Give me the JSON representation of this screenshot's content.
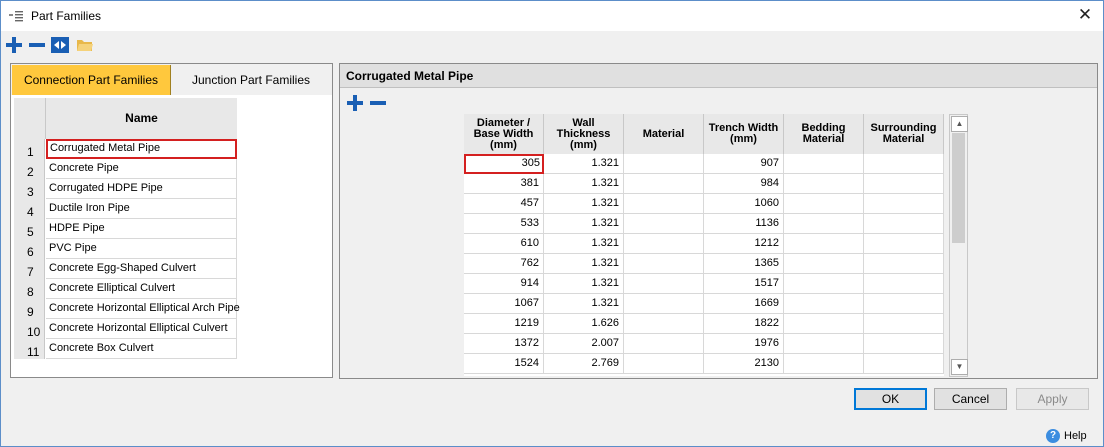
{
  "window": {
    "title": "Part Families",
    "close_glyph": "✕"
  },
  "toolbar": {
    "icons": [
      "add-icon",
      "remove-icon",
      "merge-icon",
      "open-folder-icon"
    ]
  },
  "tabs": [
    {
      "label": "Connection Part Families"
    },
    {
      "label": "Junction Part Families"
    }
  ],
  "families": {
    "header": "Name",
    "items": [
      {
        "num": "1",
        "name": "Corrugated Metal Pipe"
      },
      {
        "num": "2",
        "name": "Concrete Pipe"
      },
      {
        "num": "3",
        "name": "Corrugated HDPE Pipe"
      },
      {
        "num": "4",
        "name": "Ductile Iron Pipe"
      },
      {
        "num": "5",
        "name": "HDPE Pipe"
      },
      {
        "num": "6",
        "name": "PVC Pipe"
      },
      {
        "num": "7",
        "name": "Concrete Egg-Shaped Culvert"
      },
      {
        "num": "8",
        "name": "Concrete Elliptical Culvert"
      },
      {
        "num": "9",
        "name": "Concrete Horizontal Elliptical Arch Pipe"
      },
      {
        "num": "10",
        "name": "Concrete Horizontal Elliptical Culvert"
      },
      {
        "num": "11",
        "name": "Concrete Box Culvert"
      }
    ]
  },
  "detail": {
    "title": "Corrugated Metal Pipe",
    "columns": [
      "Diameter / Base Width (mm)",
      "Wall Thickness (mm)",
      "Material",
      "Trench Width (mm)",
      "Bedding Material",
      "Surrounding Material"
    ],
    "rows": [
      [
        "305",
        "1.321",
        "",
        "907",
        "",
        ""
      ],
      [
        "381",
        "1.321",
        "",
        "984",
        "",
        ""
      ],
      [
        "457",
        "1.321",
        "",
        "1060",
        "",
        ""
      ],
      [
        "533",
        "1.321",
        "",
        "1136",
        "",
        ""
      ],
      [
        "610",
        "1.321",
        "",
        "1212",
        "",
        ""
      ],
      [
        "762",
        "1.321",
        "",
        "1365",
        "",
        ""
      ],
      [
        "914",
        "1.321",
        "",
        "1517",
        "",
        ""
      ],
      [
        "1067",
        "1.321",
        "",
        "1669",
        "",
        ""
      ],
      [
        "1219",
        "1.626",
        "",
        "1822",
        "",
        ""
      ],
      [
        "1372",
        "2.007",
        "",
        "1976",
        "",
        ""
      ],
      [
        "1524",
        "2.769",
        "",
        "2130",
        "",
        ""
      ]
    ]
  },
  "buttons": {
    "ok": "OK",
    "cancel": "Cancel",
    "apply": "Apply",
    "help": "Help"
  },
  "colors": {
    "accent_tab": "#ffc83d",
    "selection_border": "#d42020",
    "ok_border": "#0078d7",
    "icon_blue": "#1a5fb4"
  }
}
